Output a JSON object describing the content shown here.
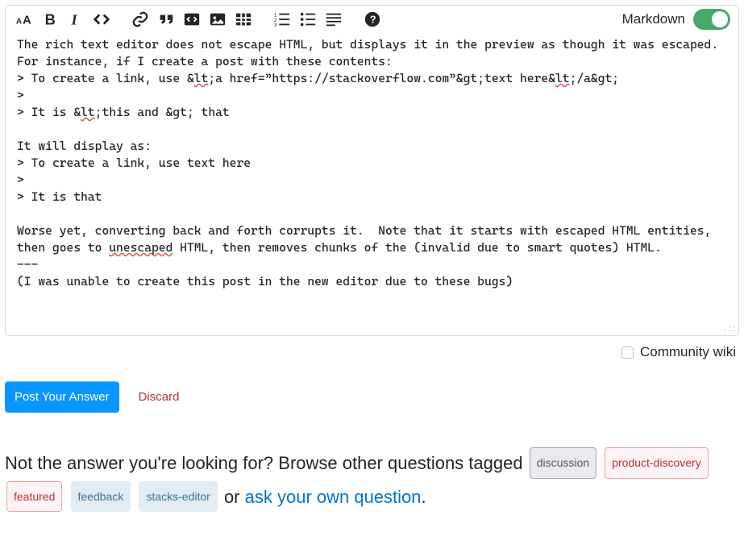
{
  "toolbar": {
    "markdown_label": "Markdown",
    "markdown_on": true
  },
  "editor": {
    "line1": "The rich text editor does not escape HTML, but displays it in the preview as though it was escaped.",
    "line2": "For instance, if I create a post with these contents:",
    "line3_pre": "> To create a link, use &",
    "line3_sq1": "lt",
    "line3_mid1": ";a href=”https://stackoverflow.com”&gt;text here&",
    "line3_sq2": "lt",
    "line3_post": ";/a&gt;",
    "line4": ">",
    "line5_pre": "> It is &",
    "line5_sq1": "lt",
    "line5_post": ";this and &gt; that",
    "line6": "",
    "line7": "It will display as:",
    "line8": "> To create a link, use text here",
    "line9": ">",
    "line10": "> It is that",
    "line11": "",
    "line12": "Worse yet, converting back and forth corrupts it.  Note that it starts with escaped HTML entities, then goes to ",
    "line12_sq": "unescaped",
    "line12_post": " HTML, then removes chunks of the (invalid due to smart quotes) HTML.",
    "line13": "---",
    "line14": "(I was unable to create this post in the new editor due to these bugs)"
  },
  "wiki_label": "Community wiki",
  "actions": {
    "post": "Post Your Answer",
    "discard": "Discard"
  },
  "footer": {
    "lead": "Not the answer you're looking for? Browse other questions tagged ",
    "or": " or ",
    "ask": "ask your own question",
    "period": "."
  },
  "tags": {
    "discussion": "discussion",
    "product_discovery": "product-discovery",
    "featured": "featured",
    "feedback": "feedback",
    "stacks_editor": "stacks-editor"
  }
}
